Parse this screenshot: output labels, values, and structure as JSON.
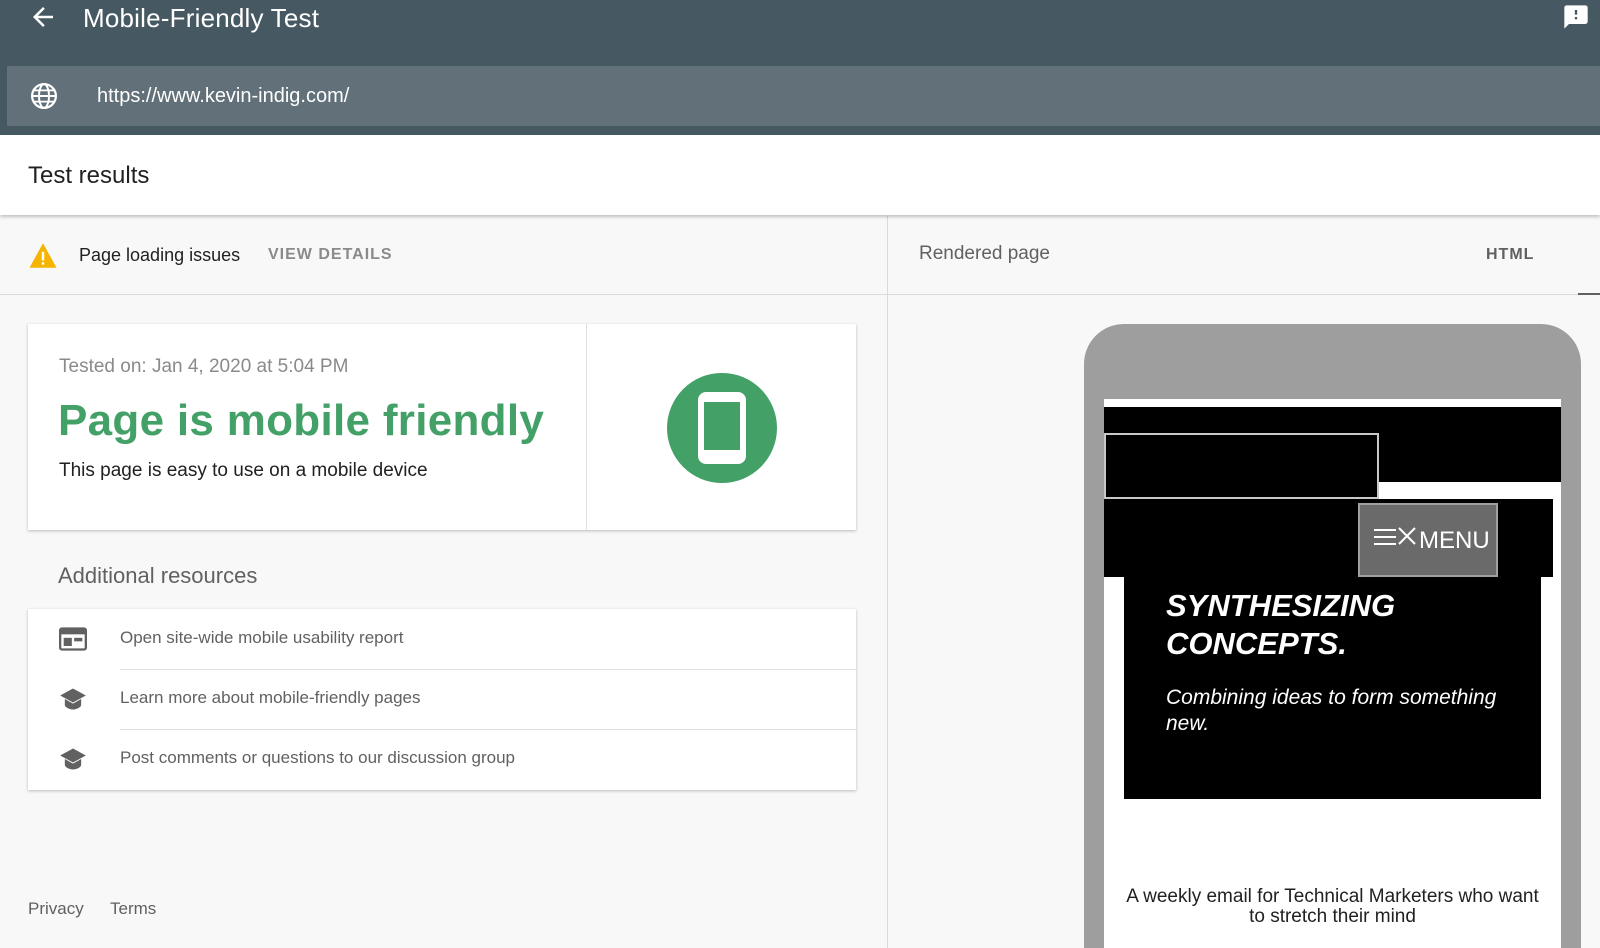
{
  "app": {
    "title": "Mobile-Friendly Test",
    "back_icon": "arrow-back-icon",
    "feedback_icon": "feedback-icon"
  },
  "url_bar": {
    "icon": "globe-icon",
    "value": "https://www.kevin-indig.com/"
  },
  "results": {
    "title": "Test results"
  },
  "issues": {
    "icon": "warning-icon",
    "label": "Page loading issues",
    "action": "VIEW DETAILS"
  },
  "result_card": {
    "tested_on": "Tested on: Jan 4, 2020 at 5:04 PM",
    "verdict": "Page is mobile friendly",
    "description": "This page is easy to use on a mobile device",
    "badge_icon": "smartphone-icon",
    "verdict_color": "#43a067"
  },
  "additional_resources": {
    "title": "Additional resources",
    "items": [
      {
        "icon": "web-layout-icon",
        "label": "Open site-wide mobile usability report"
      },
      {
        "icon": "school-icon",
        "label": "Learn more about mobile-friendly pages"
      },
      {
        "icon": "school-icon",
        "label": "Post comments or questions to our discussion group"
      }
    ]
  },
  "footer": {
    "privacy": "Privacy",
    "terms": "Terms"
  },
  "rendered_page": {
    "label": "Rendered page",
    "tab": "HTML",
    "preview": {
      "menu_label": "MENU",
      "hero_title": "SYNTHESIZING CONCEPTS.",
      "hero_subtitle": "Combining ideas to form something new.",
      "newsletter": "A weekly email for Technical Marketers who want to stretch their mind"
    }
  },
  "colors": {
    "topbar": "#465962",
    "urlbar": "#617079",
    "success_green": "#43a067",
    "warning_amber": "#f4b400"
  }
}
